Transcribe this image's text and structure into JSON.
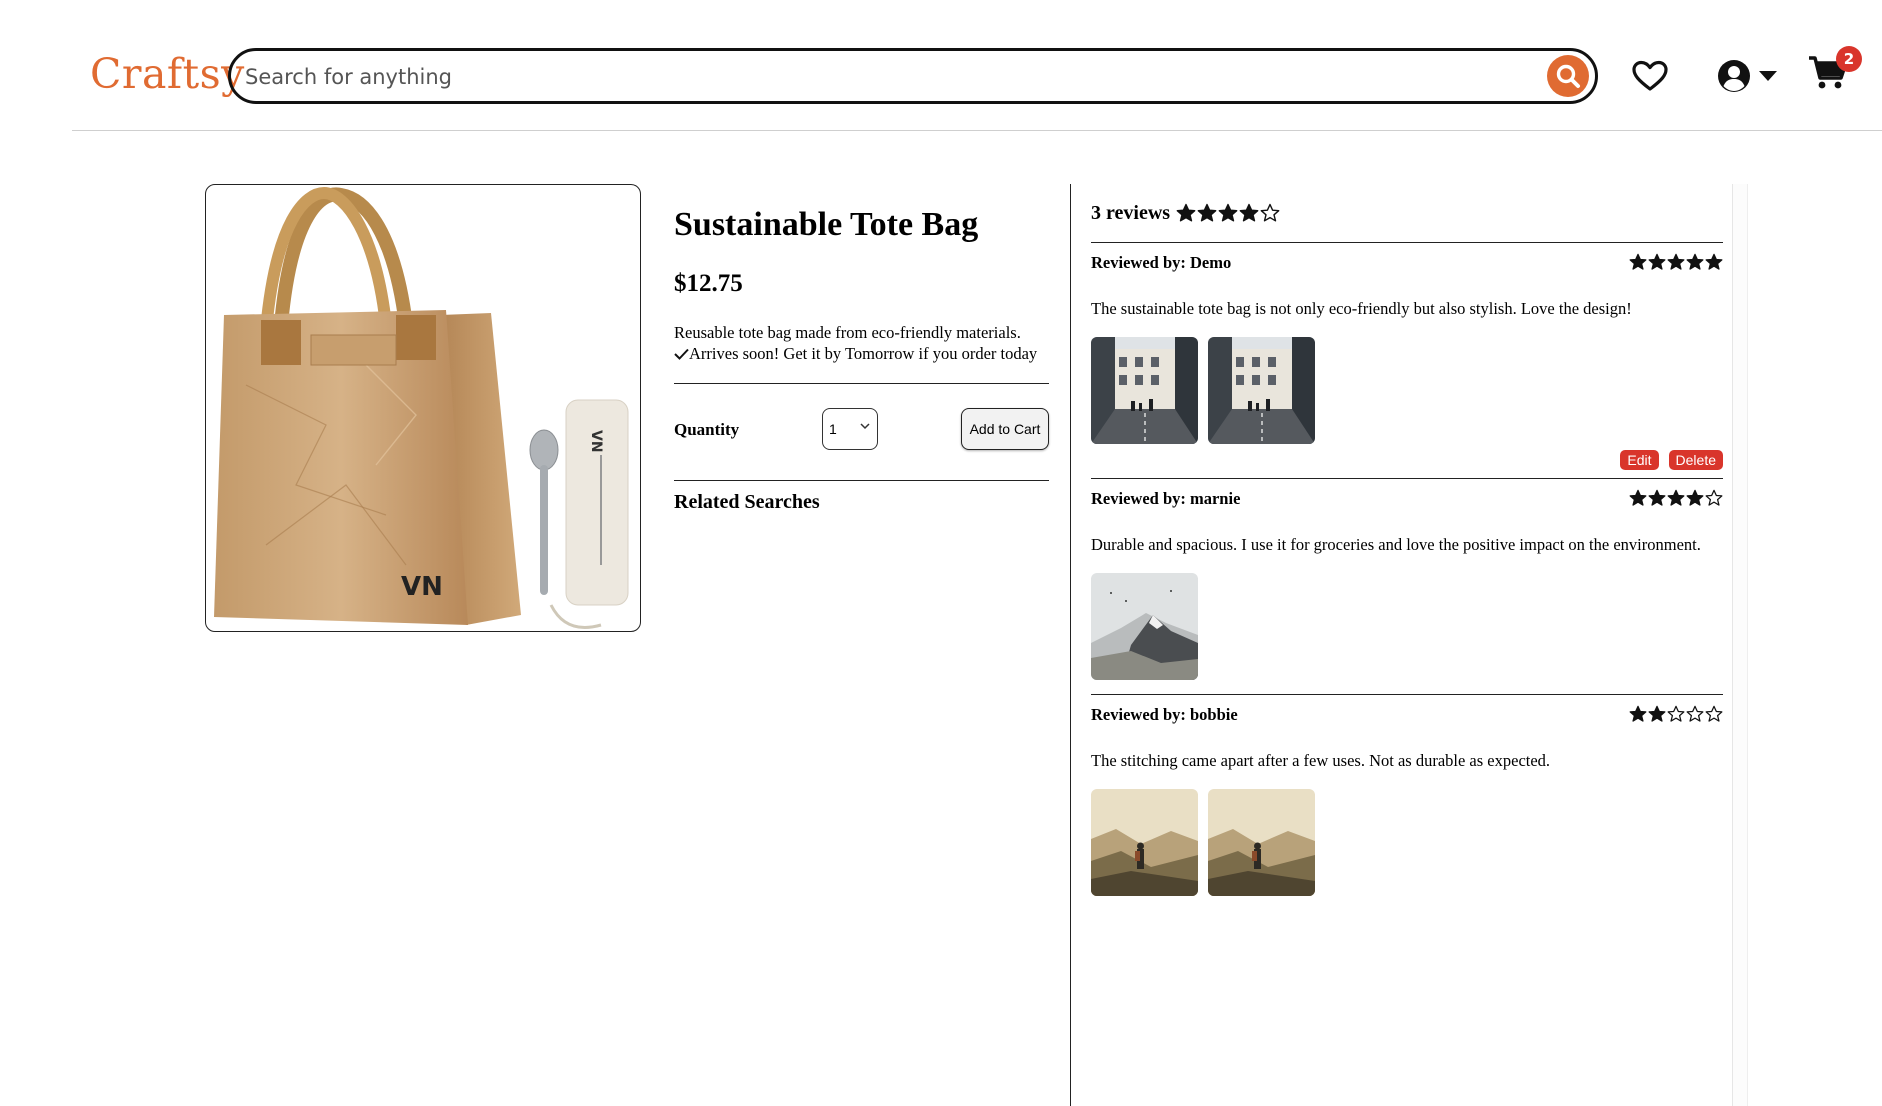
{
  "brand": {
    "name": "Craftsy",
    "accent": "#e06b32",
    "badge_color": "#d9352b"
  },
  "header": {
    "search_placeholder": "Search for anything",
    "cart_count": "2",
    "icons": [
      "search-icon",
      "heart-icon",
      "account-icon",
      "caret-down-icon",
      "cart-icon"
    ]
  },
  "product": {
    "title": "Sustainable Tote Bag",
    "price": "$12.75",
    "description": "Reusable tote bag made from eco-friendly materials.",
    "shipping": "Arrives soon! Get it by Tomorrow if you order today",
    "quantity_label": "Quantity",
    "quantity_value": "1",
    "add_to_cart": "Add to Cart",
    "related_searches": "Related Searches"
  },
  "reviews": {
    "summary": "3 reviews",
    "average_rating": 4,
    "items": [
      {
        "reviewer": "Reviewed by: Demo",
        "rating": 5,
        "text": "The sustainable tote bag is not only eco-friendly but also stylish. Love the design!",
        "photos": 2,
        "edit_label": "Edit",
        "delete_label": "Delete"
      },
      {
        "reviewer": "Reviewed by: marnie",
        "rating": 4,
        "text": "Durable and spacious. I use it for groceries and love the positive impact on the environment.",
        "photos": 1
      },
      {
        "reviewer": "Reviewed by: bobbie",
        "rating": 2,
        "text": "The stitching came apart after a few uses. Not as durable as expected.",
        "photos": 2
      }
    ]
  }
}
